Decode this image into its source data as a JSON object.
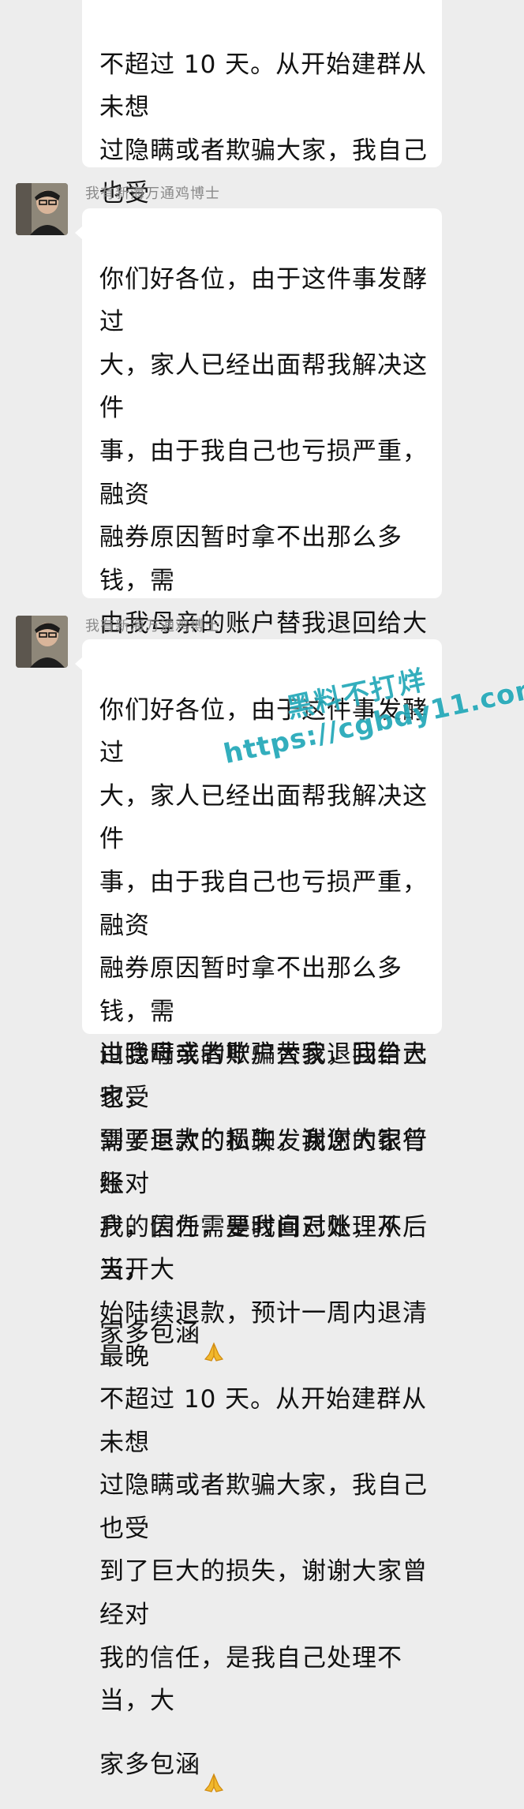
{
  "messages": [
    {
      "text": "不超过 10 天。从开始建群从未想\n过隐瞒或者欺骗大家，我自己也受\n到了巨大的损失，谢谢大家曾经对\n我的信任，是我自己处理不当，大\n家多包涵",
      "emoji": "folded-hands"
    },
    {
      "sender": "我有新海万通鸡博士",
      "text": "你们好各位，由于这件事发酵过\n大，家人已经出面帮我解决这件\n事，由于我自己也亏损严重，融资\n融券原因暂时拿不出那么多钱，需\n由我母亲的账户替我退回给大家，\n需要退款的私聊发我您的银行账\n户，因为需要时间对账，从后天开\n始陆续退款，预计一周内退清最晚\n不超过 10 天。从开始建群从未想\n过隐瞒或者欺骗大家，我自己也受\n到了巨大的损失，谢谢大家曾经对\n我的信任，是我自己处理不当，大\n家多包涵",
      "emoji": "folded-hands"
    },
    {
      "sender": "我有新海万通鸡博士",
      "text": "你们好各位，由于这件事发酵过\n大，家人已经出面帮我解决这件\n事，由于我自己也亏损严重，融资\n融券原因暂时拿不出那么多钱，需\n由我母亲的账户替我退回给大家，\n需要退款的私聊发我您的银行账\n户，因为需要时间对账，从后天开\n始陆续退款，预计一周内退清最晚\n不超过 10 天。从开始建群从未想\n过隐瞒或者欺骗大家，我自己也受\n到了巨大的损失，谢谢大家曾经对\n我的信任，是我自己处理不当，大\n家多包涵",
      "emoji": "folded-hands"
    }
  ],
  "watermark": {
    "line1": "黑料不打烊",
    "line2": "https://cgbdy11.com"
  },
  "colors": {
    "background": "#ededed",
    "bubble": "#ffffff",
    "sender_name": "#8a8a8a",
    "watermark": "#22a8b8"
  }
}
